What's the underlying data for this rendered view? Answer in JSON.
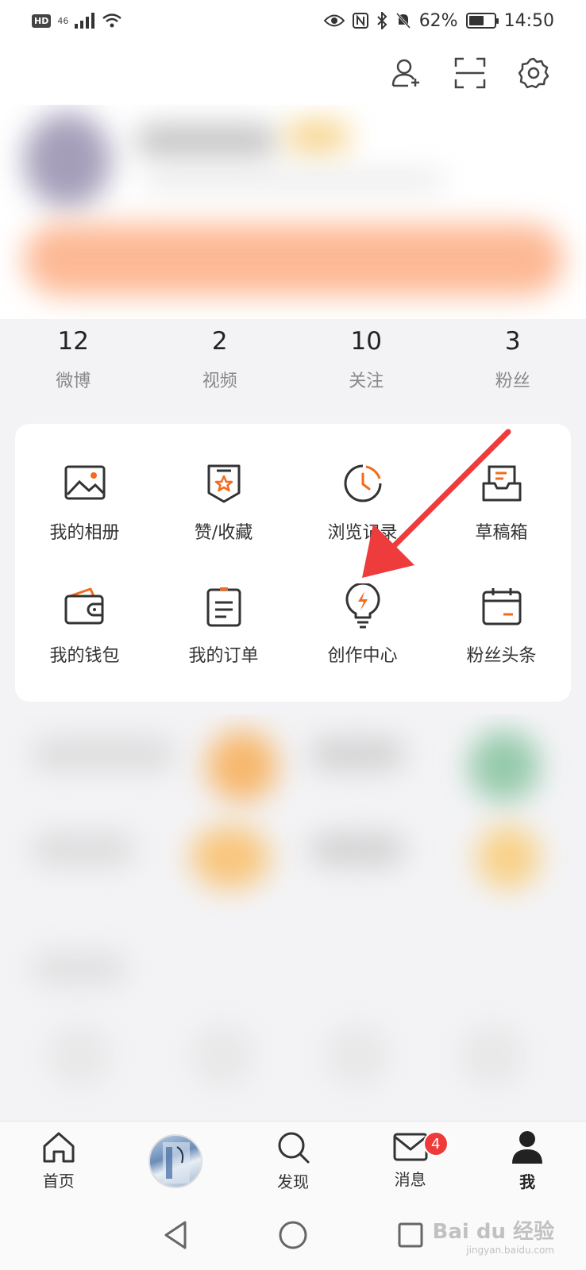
{
  "status_bar": {
    "hd": "HD",
    "network": "46",
    "battery_percent": "62%",
    "battery_level": 0.62,
    "time": "14:50"
  },
  "top_actions": {
    "icons": [
      "add-user-icon",
      "scan-icon",
      "settings-icon"
    ]
  },
  "stats": [
    {
      "value": "12",
      "label": "微博"
    },
    {
      "value": "2",
      "label": "视频"
    },
    {
      "value": "10",
      "label": "关注"
    },
    {
      "value": "3",
      "label": "粉丝"
    }
  ],
  "menu": [
    {
      "label": "我的相册",
      "icon": "album-icon"
    },
    {
      "label": "赞/收藏",
      "icon": "favorites-icon"
    },
    {
      "label": "浏览记录",
      "icon": "history-icon"
    },
    {
      "label": "草稿箱",
      "icon": "drafts-icon"
    },
    {
      "label": "我的钱包",
      "icon": "wallet-icon"
    },
    {
      "label": "我的订单",
      "icon": "orders-icon"
    },
    {
      "label": "创作中心",
      "icon": "lightbulb-icon"
    },
    {
      "label": "粉丝头条",
      "icon": "calendar-icon"
    }
  ],
  "tabs": [
    {
      "label": "首页",
      "icon": "home-icon"
    },
    {
      "label": "",
      "icon": "book-avatar"
    },
    {
      "label": "发现",
      "icon": "search-icon"
    },
    {
      "label": "消息",
      "icon": "mail-icon",
      "badge": "4"
    },
    {
      "label": "我",
      "icon": "person-icon"
    }
  ],
  "watermark": {
    "brand": "Bai du 经验",
    "url": "jingyan.baidu.com"
  },
  "colors": {
    "accent": "#f26b1d",
    "badge": "#f03a3a",
    "arrow": "#ee3b3b"
  }
}
